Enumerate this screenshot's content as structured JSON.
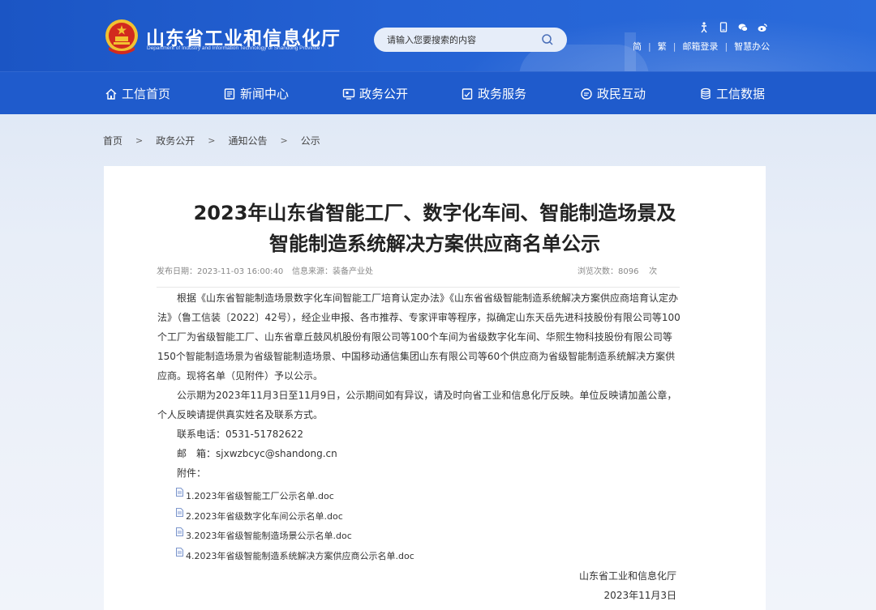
{
  "header": {
    "site_title": "山东省工业和信息化厅",
    "site_subtitle": "Department of Industry and Information Technology of Shandong Province",
    "search_placeholder": "请输入您要搜索的内容",
    "links": [
      "简",
      "繁",
      "邮箱登录",
      "智慧办公"
    ]
  },
  "nav": {
    "items": [
      {
        "label": "工信首页",
        "icon": "home-icon"
      },
      {
        "label": "新闻中心",
        "icon": "news-icon"
      },
      {
        "label": "政务公开",
        "icon": "monitor-icon"
      },
      {
        "label": "政务服务",
        "icon": "service-icon"
      },
      {
        "label": "政民互动",
        "icon": "chat-icon"
      },
      {
        "label": "工信数据",
        "icon": "database-icon"
      }
    ]
  },
  "breadcrumb": [
    "首页",
    "政务公开",
    "通知公告",
    "公示"
  ],
  "breadcrumb_separator": ">",
  "article": {
    "title_line1": "2023年山东省智能工厂、数字化车间、智能制造场景及",
    "title_line2": "智能制造系统解决方案供应商名单公示",
    "publish_label": "发布日期：",
    "publish_date": "2023-11-03 16:00:40",
    "source_label": "信息来源：",
    "source": "装备产业处",
    "views_label": "浏览次数：",
    "views": "8096",
    "views_unit": "次",
    "para1": "根据《山东省智能制造场景数字化车间智能工厂培育认定办法》《山东省省级智能制造系统解决方案供应商培育认定办法》（鲁工信装〔2022〕42号），经企业申报、各市推荐、专家评审等程序，拟确定山东天岳先进科技股份有限公司等100个工厂为省级智能工厂、山东省章丘鼓风机股份有限公司等100个车间为省级数字化车间、华熙生物科技股份有限公司等150个智能制造场景为省级智能制造场景、中国移动通信集团山东有限公司等60个供应商为省级智能制造系统解决方案供应商。现将名单（见附件）予以公示。",
    "para2": "公示期为2023年11月3日至11月9日，公示期间如有异议，请及时向省工业和信息化厅反映。单位反映请加盖公章，个人反映请提供真实姓名及联系方式。",
    "phone_line": "联系电话：0531-51782622",
    "email_line": "邮　箱：sjxwzbcyc@shandong.cn",
    "attachments_label": "附件：",
    "attachments": [
      "1.2023年省级智能工厂公示名单.doc",
      "2.2023年省级数字化车间公示名单.doc",
      "3.2023年省级智能制造场景公示名单.doc",
      "4.2023年省级智能制造系统解决方案供应商公示名单.doc"
    ],
    "sign_org": "山东省工业和信息化厅",
    "sign_date": "2023年11月3日"
  },
  "colors": {
    "header_blue": "#2462d4",
    "nav_blue": "#1f5bcc",
    "emblem_red": "#d22a1e",
    "emblem_gold": "#f2c230"
  }
}
